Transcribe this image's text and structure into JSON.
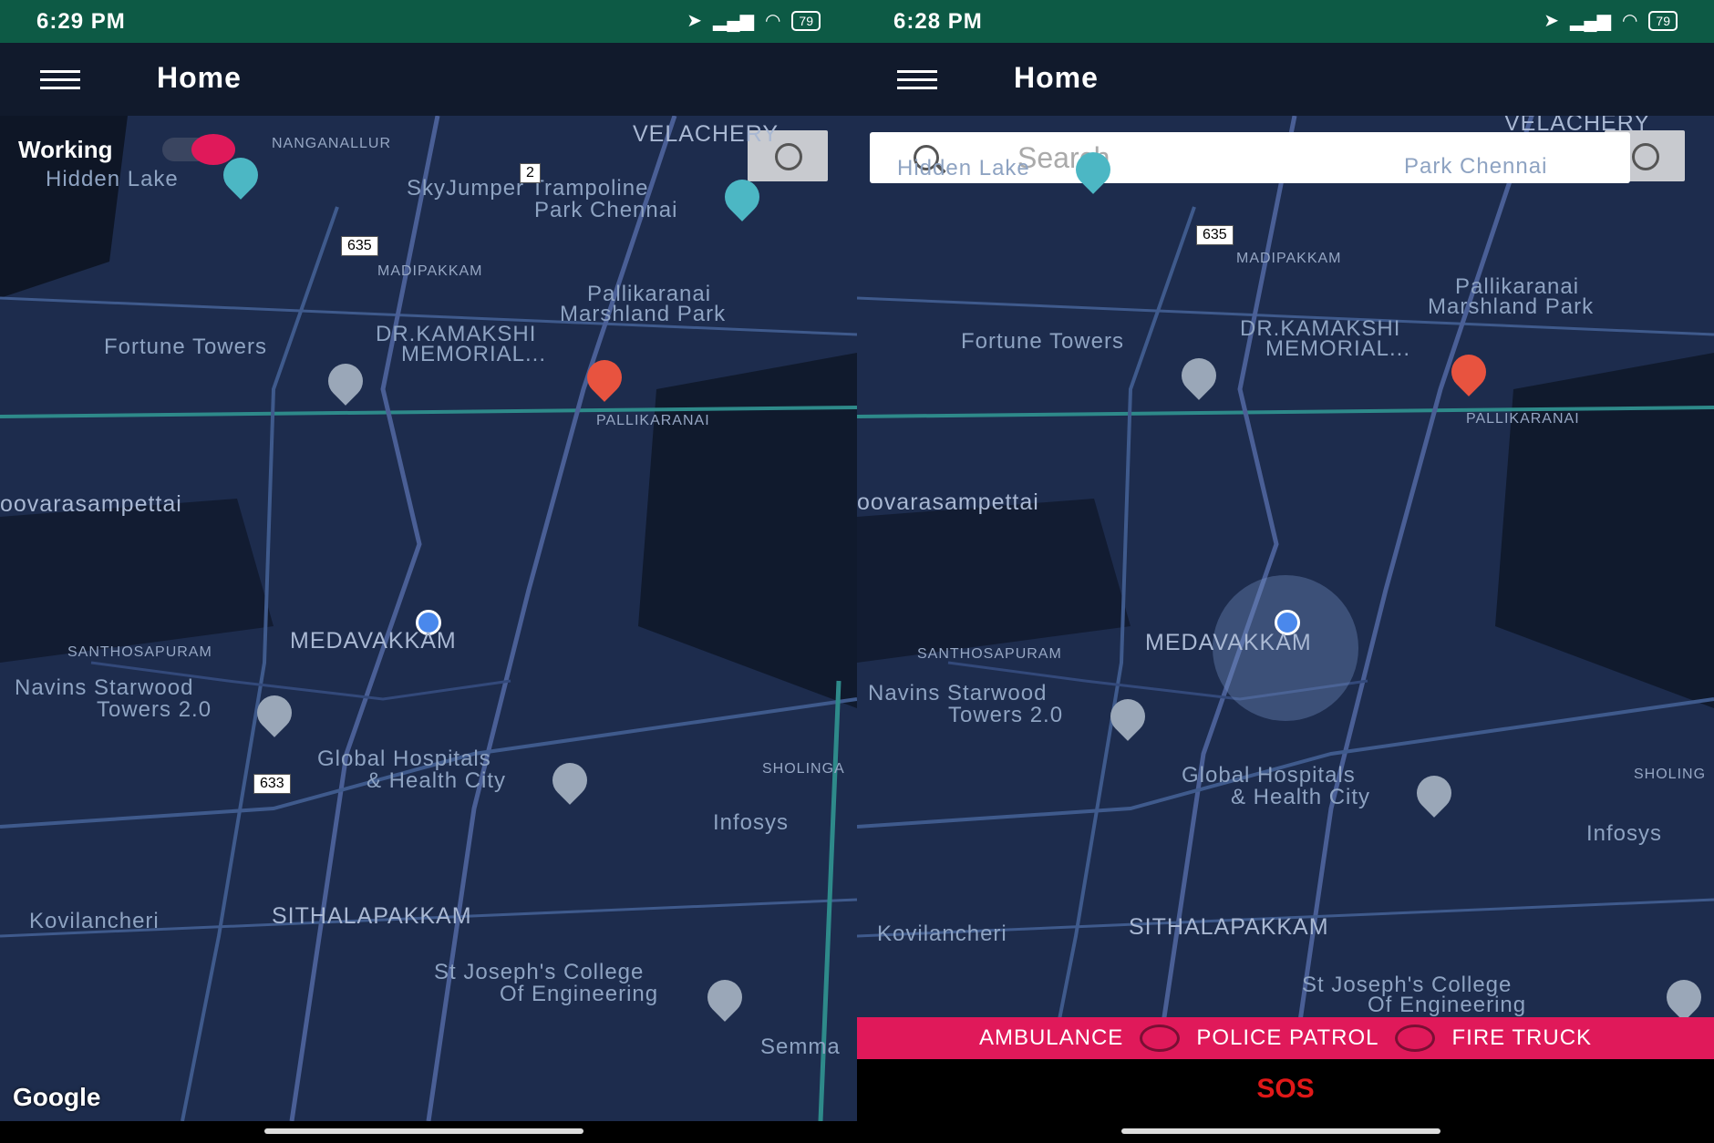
{
  "left": {
    "status": {
      "time": "6:29 PM",
      "battery": "79"
    },
    "appbar": {
      "title": "Home"
    },
    "toggle_label": "Working",
    "attribution": "Google",
    "map_labels": {
      "velachery": "VELACHERY",
      "nanganallur": "NANGANALLUR",
      "hidden_lake": "Hidden Lake",
      "skyjumper": "SkyJumper Trampoline",
      "park_chennai": "Park Chennai",
      "madipakkam": "MADIPAKKAM",
      "pallikaranai_park_1": "Pallikaranai",
      "pallikaranai_park_2": "Marshland Park",
      "fortune": "Fortune Towers",
      "kamakshi_1": "DR.KAMAKSHI",
      "kamakshi_2": "MEMORIAL...",
      "poovarasampettai": "oovarasampettai",
      "pallikaranai": "PALLIKARANAI",
      "medavakkam": "MEDAVAKKAM",
      "santhosapuram": "SANTHOSAPURAM",
      "navins_1": "Navins Starwood",
      "navins_2": "Towers 2.0",
      "global_1": "Global Hospitals",
      "global_2": "& Health City",
      "sholinga": "SHOLINGA",
      "infosys": "Infosys",
      "kovilancheri": "Kovilancheri",
      "sithalapakkam": "SITHALAPAKKAM",
      "stjoseph_1": "St Joseph's College",
      "stjoseph_2": "Of Engineering",
      "semma": "Semma",
      "road_2": "2",
      "road_635": "635",
      "road_633": "633"
    }
  },
  "right": {
    "status": {
      "time": "6:28 PM",
      "battery": "79"
    },
    "appbar": {
      "title": "Home"
    },
    "search": {
      "placeholder": "Search"
    },
    "services": {
      "ambulance": "AMBULANCE",
      "police": "POLICE PATROL",
      "fire": "FIRE TRUCK"
    },
    "sos_label": "SOS",
    "map_labels": {
      "velachery": "VELACHERY",
      "hidden_lake": "Hidden Lake",
      "park_chennai": "Park Chennai",
      "madipakkam": "MADIPAKKAM",
      "pallikaranai_park_1": "Pallikaranai",
      "pallikaranai_park_2": "Marshland Park",
      "fortune": "Fortune Towers",
      "kamakshi_1": "DR.KAMAKSHI",
      "kamakshi_2": "MEMORIAL...",
      "poovarasampettai": "oovarasampettai",
      "pallikaranai": "PALLIKARANAI",
      "medavakkam": "MEDAVAKKAM",
      "santhosapuram": "SANTHOSAPURAM",
      "navins_1": "Navins Starwood",
      "navins_2": "Towers 2.0",
      "global_1": "Global Hospitals",
      "global_2": "& Health City",
      "sholinga": "SHOLING",
      "infosys": "Infosys",
      "kovilancheri": "Kovilancheri",
      "sithalapakkam": "SITHALAPAKKAM",
      "stjoseph_1": "St Joseph's College",
      "stjoseph_2": "Of Engineering",
      "road_635": "635"
    }
  },
  "colors": {
    "status_bar": "#0d5a45",
    "app_bar": "#111a2c",
    "map_bg": "#1d2c4d",
    "accent": "#e0195a",
    "sos": "#e01818"
  },
  "icons": [
    "menu-icon",
    "navigation-icon",
    "signal-icon",
    "wifi-icon",
    "battery-icon",
    "my-location-icon",
    "search-icon",
    "map-pin-icon",
    "hospital-icon",
    "camera-icon",
    "school-icon",
    "bus-icon",
    "park-icon"
  ]
}
